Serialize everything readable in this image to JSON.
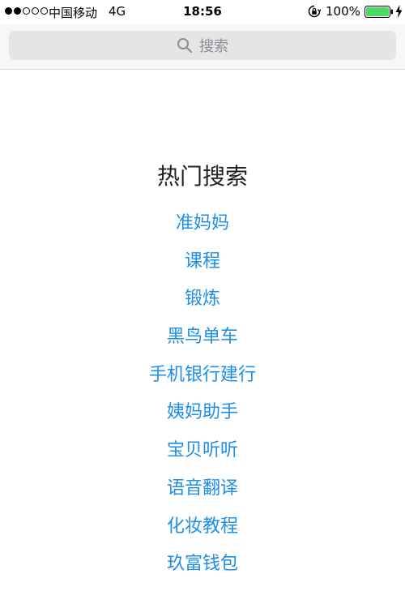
{
  "status_bar": {
    "carrier": "中国移动",
    "network": "4G",
    "time": "18:56",
    "battery_percent": "100%",
    "signal_filled": 2,
    "signal_total": 5,
    "icons": [
      "rotation-lock-icon",
      "battery-icon",
      "charging-icon"
    ],
    "battery_color": "#4cd964"
  },
  "search": {
    "placeholder": "搜索",
    "icon": "search-icon"
  },
  "hot_search": {
    "title": "热门搜索",
    "items": [
      "准妈妈",
      "课程",
      "锻炼",
      "黑鸟单车",
      "手机银行建行",
      "姨妈助手",
      "宝贝听听",
      "语音翻译",
      "化妆教程",
      "玖富钱包"
    ]
  },
  "colors": {
    "link": "#1e8ee8",
    "title": "#222222",
    "search_box_bg": "#e5e5e7",
    "header_bg": "#f7f7f7"
  }
}
